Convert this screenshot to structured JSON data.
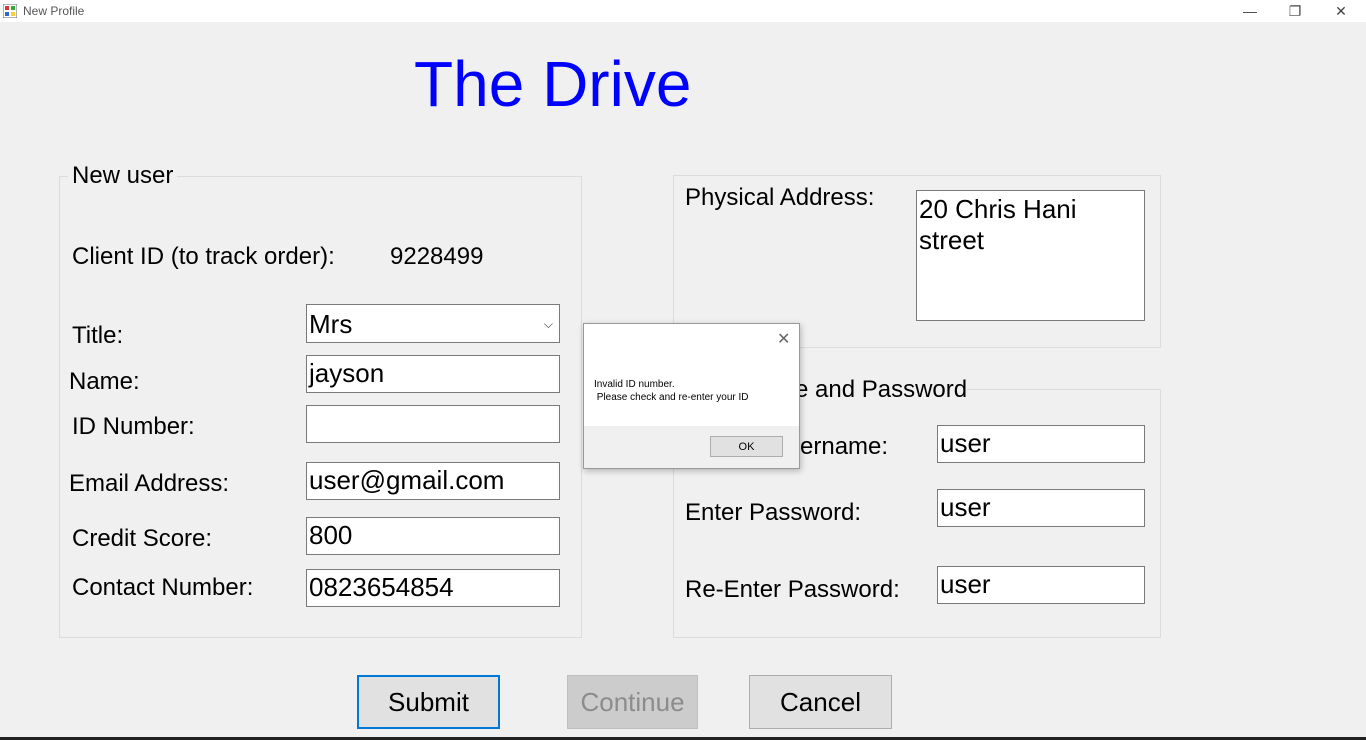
{
  "window": {
    "title": "New Profile",
    "minimize_glyph": "—",
    "maximize_glyph": "❐",
    "close_glyph": "✕"
  },
  "heading": "The Drive",
  "new_user": {
    "legend": "New user",
    "client_id_label": "Client ID (to track order):",
    "client_id_value": "9228499",
    "title_label": "Title:",
    "title_value": "Mrs",
    "name_label": "Name:",
    "name_value": "jayson",
    "id_label": "ID Number:",
    "id_value": "",
    "email_label": "Email Address:",
    "email_value": "user@gmail.com",
    "credit_label": "Credit Score:",
    "credit_value": "800",
    "contact_label": "Contact Number:",
    "contact_value": "0823654854"
  },
  "address": {
    "label": "Physical Address:",
    "value": "20 Chris Hani street"
  },
  "credentials": {
    "legend": "e and Password",
    "username_label": "ername:",
    "username_value": "user",
    "password_label": "Enter Password:",
    "password_value": "user",
    "reenter_label": "Re-Enter Password:",
    "reenter_value": "user"
  },
  "buttons": {
    "submit": "Submit",
    "continue": "Continue",
    "cancel": "Cancel"
  },
  "message_box": {
    "text": "Invalid ID number.\n Please check and re-enter your ID",
    "ok": "OK",
    "close_glyph": "✕"
  },
  "icons": {
    "app": "app-icon",
    "dropdown": "chevron-down-icon"
  }
}
